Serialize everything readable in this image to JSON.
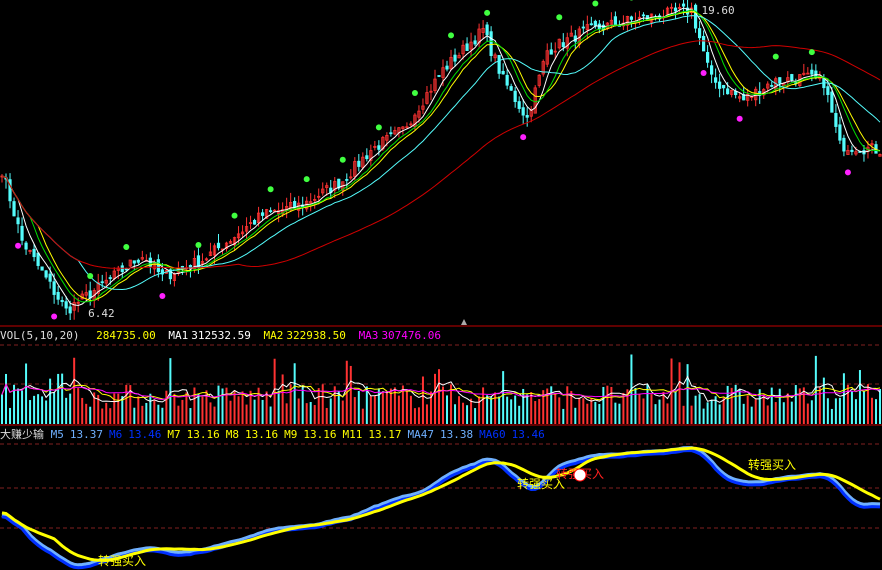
{
  "chart_data": {
    "type": "candlestick",
    "price_labels": {
      "high": "19.60",
      "low": "6.42"
    },
    "price_range": [
      6.42,
      19.6
    ],
    "bars": 220,
    "close_anchors": [
      [
        0,
        12.74
      ],
      [
        5,
        9.8
      ],
      [
        16,
        6.9
      ],
      [
        25,
        7.96
      ],
      [
        35,
        9.2
      ],
      [
        40,
        8.3
      ],
      [
        50,
        9.0
      ],
      [
        65,
        10.87
      ],
      [
        75,
        11.3
      ],
      [
        85,
        12.3
      ],
      [
        92,
        13.57
      ],
      [
        100,
        14.4
      ],
      [
        110,
        16.9
      ],
      [
        120,
        18.56
      ],
      [
        125,
        16.5
      ],
      [
        131,
        14.9
      ],
      [
        136,
        17.7
      ],
      [
        145,
        18.5
      ],
      [
        157,
        18.97
      ],
      [
        172,
        19.4
      ],
      [
        177,
        16.5
      ],
      [
        185,
        15.65
      ],
      [
        192,
        16.4
      ],
      [
        200,
        16.6
      ],
      [
        205,
        16.4
      ],
      [
        209,
        13.78
      ],
      [
        219,
        13.57
      ]
    ],
    "colors": {
      "up": "#ff3232",
      "down": "#54fcfc",
      "ma_short": "#ffffff",
      "ma_mid": "#ffff00",
      "ma_long": "#ff00ff",
      "ma_green": "#00e000",
      "ma_cyan": "#54fcfc",
      "ma_red": "#d00000"
    }
  },
  "volume_panel": {
    "title": "VOL(5,10,20)",
    "vol": "284735.00",
    "ma1_label": "MA1",
    "ma1": "312532.59",
    "ma2_label": "MA2",
    "ma2": "322938.50",
    "ma3_label": "MA3",
    "ma3": "307476.06"
  },
  "indicator_panel": {
    "title": "大赚少输",
    "items": [
      {
        "label": "M5",
        "value": "13.37",
        "color": "#6fb0ff"
      },
      {
        "label": "M6",
        "value": "13.46",
        "color": "#0030ff"
      },
      {
        "label": "M7",
        "value": "13.16",
        "color": "#ffff00"
      },
      {
        "label": "M8",
        "value": "13.16",
        "color": "#ffff00"
      },
      {
        "label": "M9",
        "value": "13.16",
        "color": "#ffff00"
      },
      {
        "label": "M11",
        "value": "13.17",
        "color": "#ffff00"
      },
      {
        "label": "MA47",
        "value": "13.38",
        "color": "#6fb0ff"
      },
      {
        "label": "MA60",
        "value": "13.46",
        "color": "#0030ff"
      }
    ],
    "signals": [
      {
        "text": "转强买入",
        "color": "#ffff00"
      },
      {
        "text": "转强买入",
        "color": "#ffff00"
      },
      {
        "text": "转强买入",
        "color": "#ff2020"
      },
      {
        "text": "转强买入",
        "color": "#ffff00"
      }
    ]
  }
}
